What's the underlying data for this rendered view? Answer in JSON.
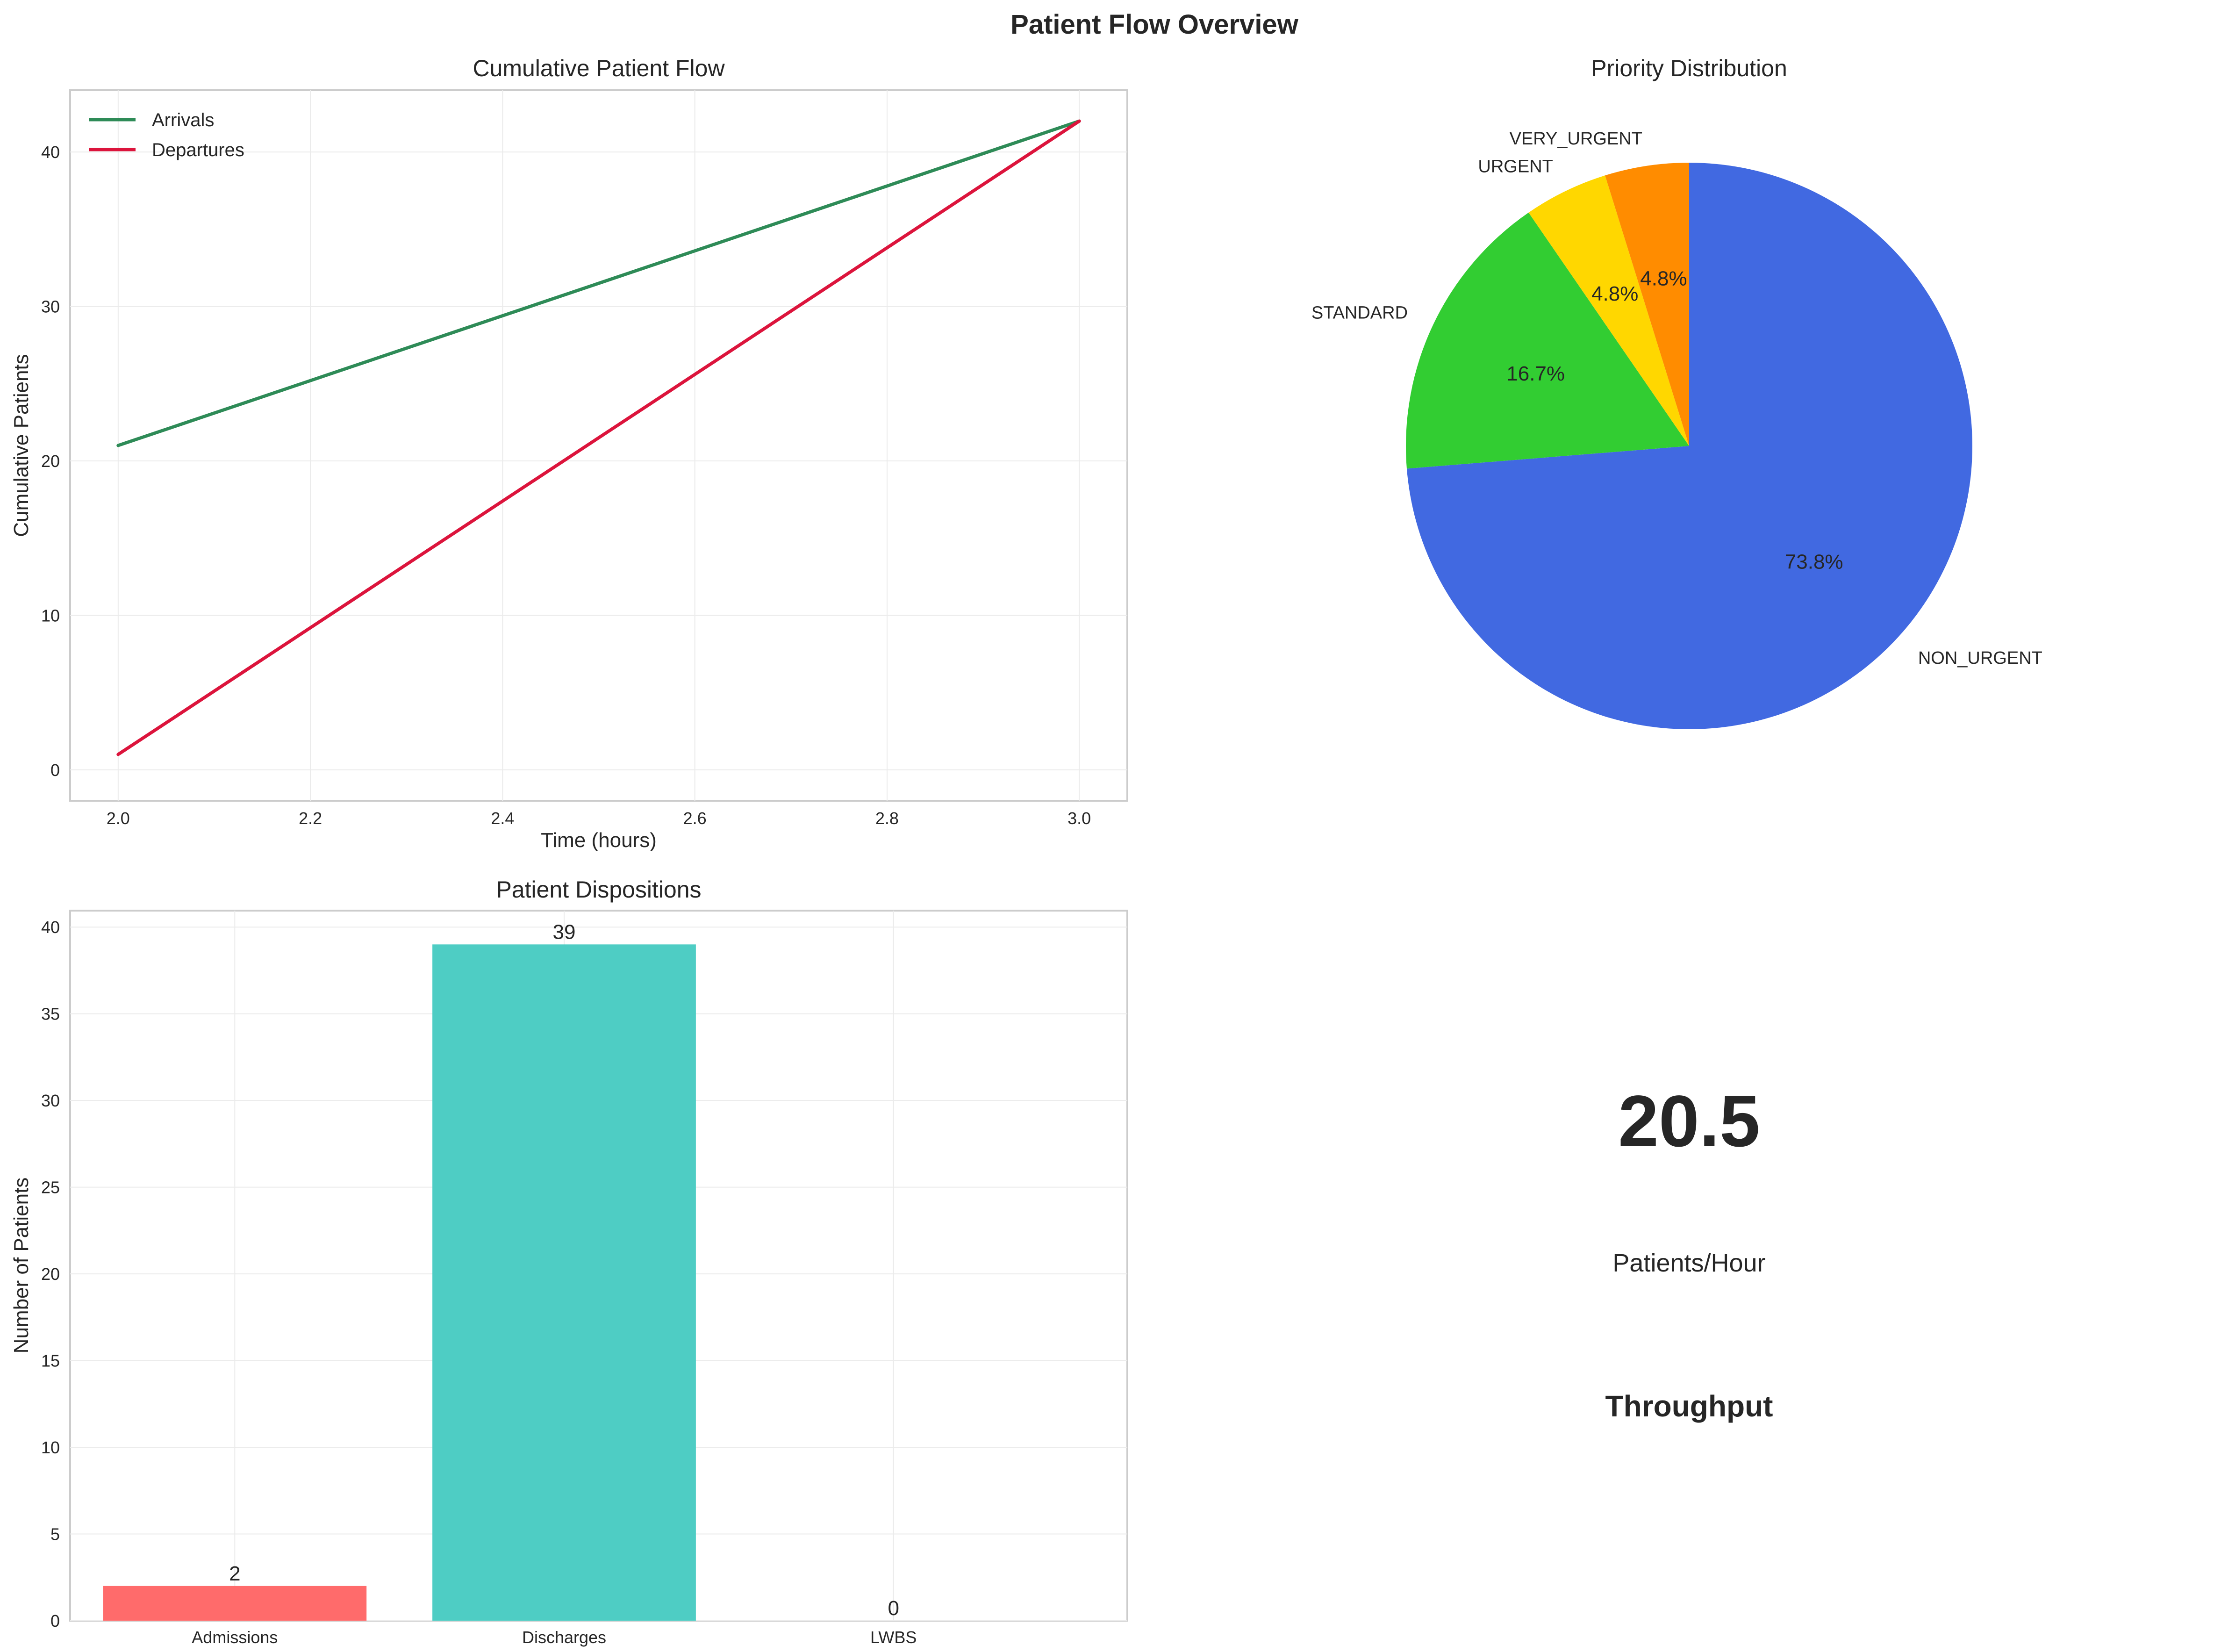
{
  "figure": {
    "title": "Patient Flow Overview"
  },
  "chart_data": [
    {
      "type": "line",
      "title": "Cumulative Patient Flow",
      "xlabel": "Time (hours)",
      "ylabel": "Cumulative Patients",
      "xlim": [
        1.95,
        3.05
      ],
      "ylim": [
        -2,
        44
      ],
      "xticks": [
        2.0,
        2.2,
        2.4,
        2.6,
        2.8,
        3.0
      ],
      "xtick_labels": [
        "2.0",
        "2.2",
        "2.4",
        "2.6",
        "2.8",
        "3.0"
      ],
      "yticks": [
        0,
        10,
        20,
        30,
        40
      ],
      "ytick_labels": [
        "0",
        "10",
        "20",
        "30",
        "40"
      ],
      "grid": true,
      "legend": "upper-left",
      "series": [
        {
          "name": "Arrivals",
          "color": "#2e8b57",
          "x": [
            2.0,
            3.0
          ],
          "y": [
            21,
            42
          ]
        },
        {
          "name": "Departures",
          "color": "#dc143c",
          "x": [
            2.0,
            3.0
          ],
          "y": [
            1,
            42
          ]
        }
      ]
    },
    {
      "type": "pie",
      "title": "Priority Distribution",
      "slices": [
        {
          "label": "NON_URGENT",
          "value": 73.8,
          "pct_label": "73.8%",
          "color": "#4169e1"
        },
        {
          "label": "STANDARD",
          "value": 16.7,
          "pct_label": "16.7%",
          "color": "#32cd32"
        },
        {
          "label": "URGENT",
          "value": 4.8,
          "pct_label": "4.8%",
          "color": "#ffd700"
        },
        {
          "label": "VERY_URGENT",
          "value": 4.8,
          "pct_label": "4.8%",
          "color": "#ff8c00"
        }
      ]
    },
    {
      "type": "bar",
      "title": "Patient Dispositions",
      "xlabel": "",
      "ylabel": "Number of Patients",
      "categories": [
        "Admissions",
        "Discharges",
        "LWBS"
      ],
      "values": [
        2,
        39,
        0
      ],
      "value_labels": [
        "2",
        "39",
        "0"
      ],
      "colors": [
        "#ff6b6b",
        "#4ecdc4",
        "#45b7d1"
      ],
      "ylim": [
        0,
        40.95
      ],
      "yticks": [
        0,
        5,
        10,
        15,
        20,
        25,
        30,
        35,
        40
      ],
      "ytick_labels": [
        "0",
        "5",
        "10",
        "15",
        "20",
        "25",
        "30",
        "35",
        "40"
      ],
      "grid": true
    }
  ],
  "metric": {
    "value": "20.5",
    "unit": "Patients/Hour",
    "label": "Throughput"
  }
}
